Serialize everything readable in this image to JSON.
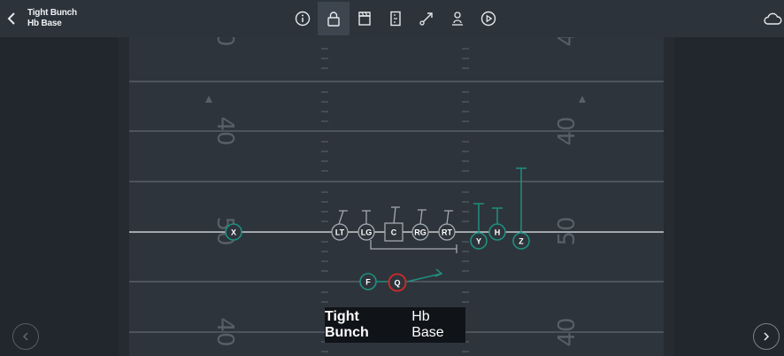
{
  "header": {
    "title_line1": "Tight Bunch",
    "title_line2": "Hb Base",
    "back_icon": "chevron-left-icon",
    "tools": [
      {
        "icon": "info-icon",
        "active": false
      },
      {
        "icon": "lock-icon",
        "active": true
      },
      {
        "icon": "clapperboard-icon",
        "active": false
      },
      {
        "icon": "field-frame-icon",
        "active": false
      },
      {
        "icon": "route-arrow-icon",
        "active": false
      },
      {
        "icon": "player-stance-icon",
        "active": false
      },
      {
        "icon": "play-icon",
        "active": false
      }
    ],
    "cloud_icon": "cloud-icon"
  },
  "field": {
    "yard_numbers": {
      "upper": "40",
      "middle": "50",
      "lower": "40"
    },
    "colors": {
      "field": "#2e343b",
      "lines": "#7c848c",
      "los": "#c8cdd2",
      "offense_ring": "#1f8f80",
      "qb_ring": "#d12b2b",
      "route": "#1f8f80",
      "block": "#a4aab0"
    }
  },
  "players": {
    "X": "X",
    "LT": "LT",
    "LG": "LG",
    "C": "C",
    "RG": "RG",
    "RT": "RT",
    "Y": "Y",
    "H": "H",
    "Z": "Z",
    "F": "F",
    "Q": "Q"
  },
  "banner": {
    "formation": "Tight Bunch",
    "play": "Hb Base"
  },
  "nav": {
    "prev_icon": "chevron-left-icon",
    "next_icon": "chevron-right-icon"
  }
}
